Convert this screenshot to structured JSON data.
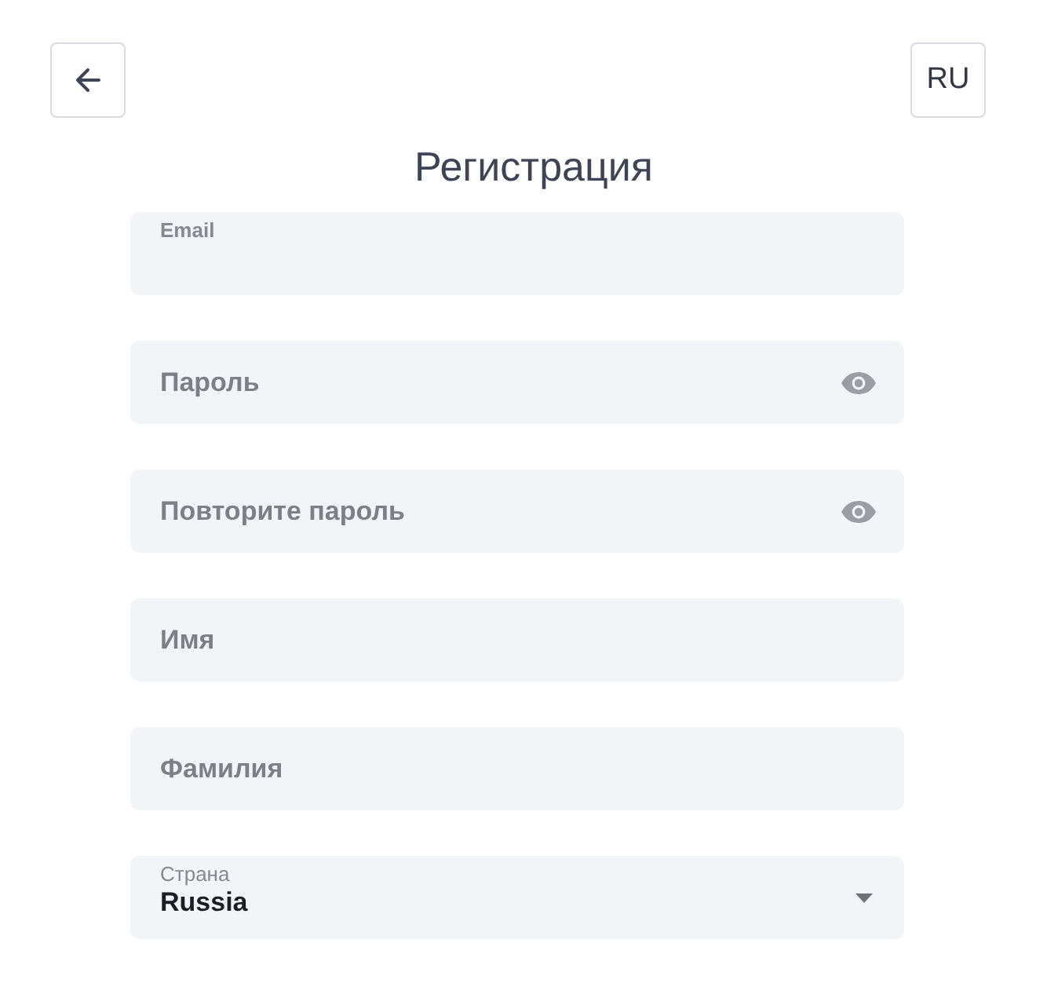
{
  "header": {
    "language": "RU"
  },
  "title": "Регистрация",
  "fields": [
    {
      "kind": "text",
      "label": "Email",
      "floated": true
    },
    {
      "kind": "password",
      "label": "Пароль",
      "floated": false
    },
    {
      "kind": "password",
      "label": "Повторите пароль",
      "floated": false
    },
    {
      "kind": "text",
      "label": "Имя",
      "floated": false
    },
    {
      "kind": "text",
      "label": "Фамилия",
      "floated": false
    },
    {
      "kind": "select",
      "label": "Страна",
      "floated": true,
      "value": "Russia"
    }
  ]
}
